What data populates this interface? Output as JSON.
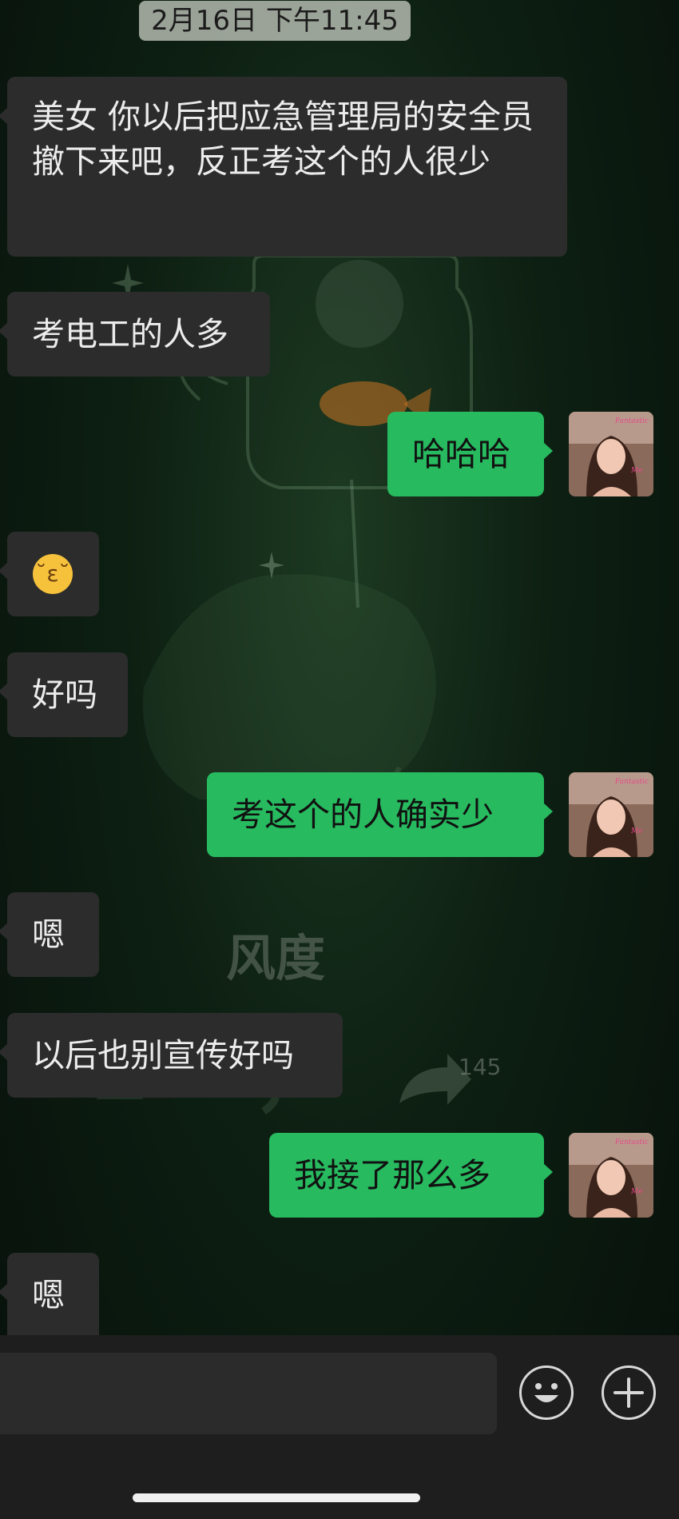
{
  "timestamp": "2月16日 下午11:45",
  "messages": [
    {
      "side": "in",
      "text": "美女 你以后把应急管理局的安全员撤下来吧，反正考这个的人很少"
    },
    {
      "side": "in",
      "text": "考电工的人多"
    },
    {
      "side": "out",
      "text": "哈哈哈"
    },
    {
      "side": "in",
      "emoji": "kissing-face"
    },
    {
      "side": "in",
      "text": "好吗"
    },
    {
      "side": "out",
      "text": "考这个的人确实少"
    },
    {
      "side": "in",
      "text": "嗯"
    },
    {
      "side": "in",
      "text": "以后也别宣传好吗"
    },
    {
      "side": "out",
      "text": "我接了那么多"
    },
    {
      "side": "in",
      "text": "嗯"
    }
  ],
  "watermark": {
    "text": "风度",
    "share_count": "145"
  },
  "avatar_overlay_text": [
    "Fantastic",
    "Me"
  ],
  "input_bar": {
    "emoji_icon": "smiley-face-icon",
    "more_icon": "plus-circle-icon"
  },
  "colors": {
    "incoming_bubble": "#2c2c2c",
    "outgoing_bubble": "#27ba5f",
    "background": "#0d1f12"
  }
}
